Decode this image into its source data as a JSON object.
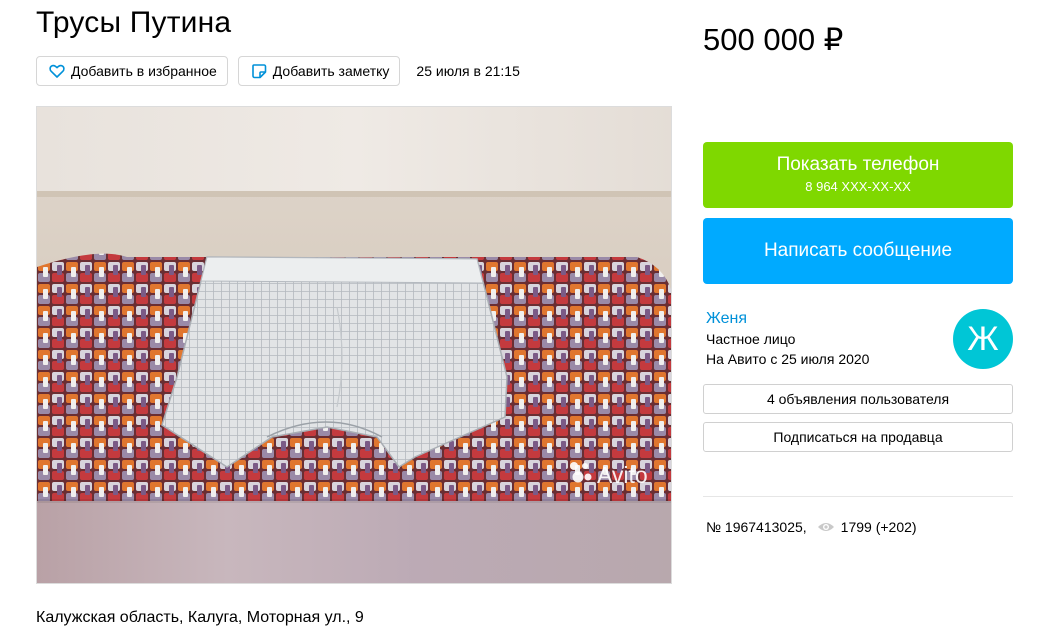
{
  "listing": {
    "title": "Трусы Путина",
    "price": "500 000 ₽",
    "date": "25 июля в 21:15",
    "address": "Калужская область, Калуга, Моторная ул., 9",
    "number": "№ 1967413025,",
    "views": "1799 (+202)"
  },
  "actions": {
    "favorite_label": "Добавить в избранное",
    "note_label": "Добавить заметку"
  },
  "gallery": {
    "watermark": "Avito"
  },
  "contact": {
    "phone_label": "Показать телефон",
    "phone_masked": "8 964 XXX-XX-XX",
    "message_label": "Написать сообщение"
  },
  "seller": {
    "name": "Женя",
    "type": "Частное лицо",
    "since": "На Авито с 25 июля 2020",
    "avatar_letter": "Ж",
    "listings_label": "4 объявления пользователя",
    "subscribe_label": "Подписаться на продавца"
  },
  "colors": {
    "phone_button": "#7fd800",
    "message_button": "#00aaff",
    "avatar": "#00c6d6",
    "link": "#0091d9",
    "favorite_icon": "#0091d9"
  },
  "icons": {
    "favorite": "heart-icon",
    "note": "note-icon",
    "views": "eye-icon"
  }
}
